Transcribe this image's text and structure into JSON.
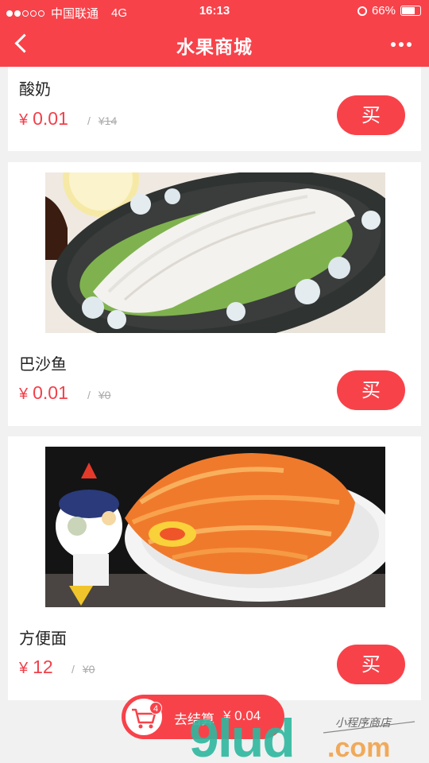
{
  "status_bar": {
    "carrier": "中国联通",
    "network": "4G",
    "time": "16:13",
    "battery": "66%",
    "battery_level": 0.66
  },
  "nav": {
    "title": "水果商城"
  },
  "products": [
    {
      "name": "酸奶",
      "currency": "¥",
      "price": "0.01",
      "slash": "/",
      "original_price": "¥14",
      "buy_label": "买"
    },
    {
      "name": "巴沙鱼",
      "currency": "¥",
      "price": "0.01",
      "slash": "/",
      "original_price": "¥0",
      "buy_label": "买"
    },
    {
      "name": "方便面",
      "currency": "¥",
      "price": "12",
      "slash": "/",
      "original_price": "¥0",
      "buy_label": "买"
    }
  ],
  "checkout": {
    "badge": "4",
    "label": "去结算",
    "total": "¥ 0.04"
  },
  "watermark": {
    "text": "9ludcom",
    "subtext": "小程序商店"
  },
  "colors": {
    "accent": "#f8424a",
    "price": "#f2404a"
  }
}
